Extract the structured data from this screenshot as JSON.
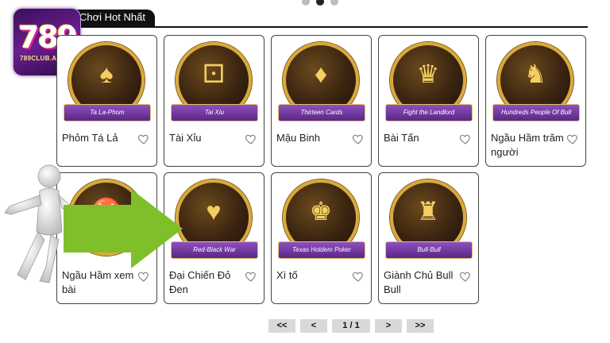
{
  "carousel": {
    "dots": 3,
    "active": 1
  },
  "logo": {
    "number": "789",
    "subtitle": "789CLUB.AI"
  },
  "section_tab": {
    "label": "Chơi Hot Nhất"
  },
  "games": [
    {
      "title": "Phỏm Tá Lả",
      "ribbon": "Ta La-Phom",
      "emblem": "♠"
    },
    {
      "title": "Tài Xỉu",
      "ribbon": "Tai Xiu",
      "emblem": "⚀"
    },
    {
      "title": "Mậu Binh",
      "ribbon": "Thirteen Cards",
      "emblem": "♦"
    },
    {
      "title": "Bài Tấn",
      "ribbon": "Fight the Landlord",
      "emblem": "♛"
    },
    {
      "title": "Ngầu Hầm trăm người",
      "ribbon": "Hundreds People Of Bull",
      "emblem": "♞"
    },
    {
      "title": "Ngầu Hầm xem bài",
      "ribbon": "",
      "emblem": "♉"
    },
    {
      "title": "Đại Chiến Đỏ Đen",
      "ribbon": "Red-Black War",
      "emblem": "♥"
    },
    {
      "title": "Xì tố",
      "ribbon": "Texas Holdem Poker",
      "emblem": "♚"
    },
    {
      "title": "Giành Chủ Bull Bull",
      "ribbon": "Bull-Bull",
      "emblem": "♜"
    }
  ],
  "pagination": {
    "first": "<<",
    "prev": "<",
    "page": "1 / 1",
    "next": ">",
    "last": ">>"
  },
  "colors": {
    "ring_gold": "#d9a93a",
    "ribbon_purple": "#6a2f98",
    "arrow_green": "#7fbf2a"
  }
}
